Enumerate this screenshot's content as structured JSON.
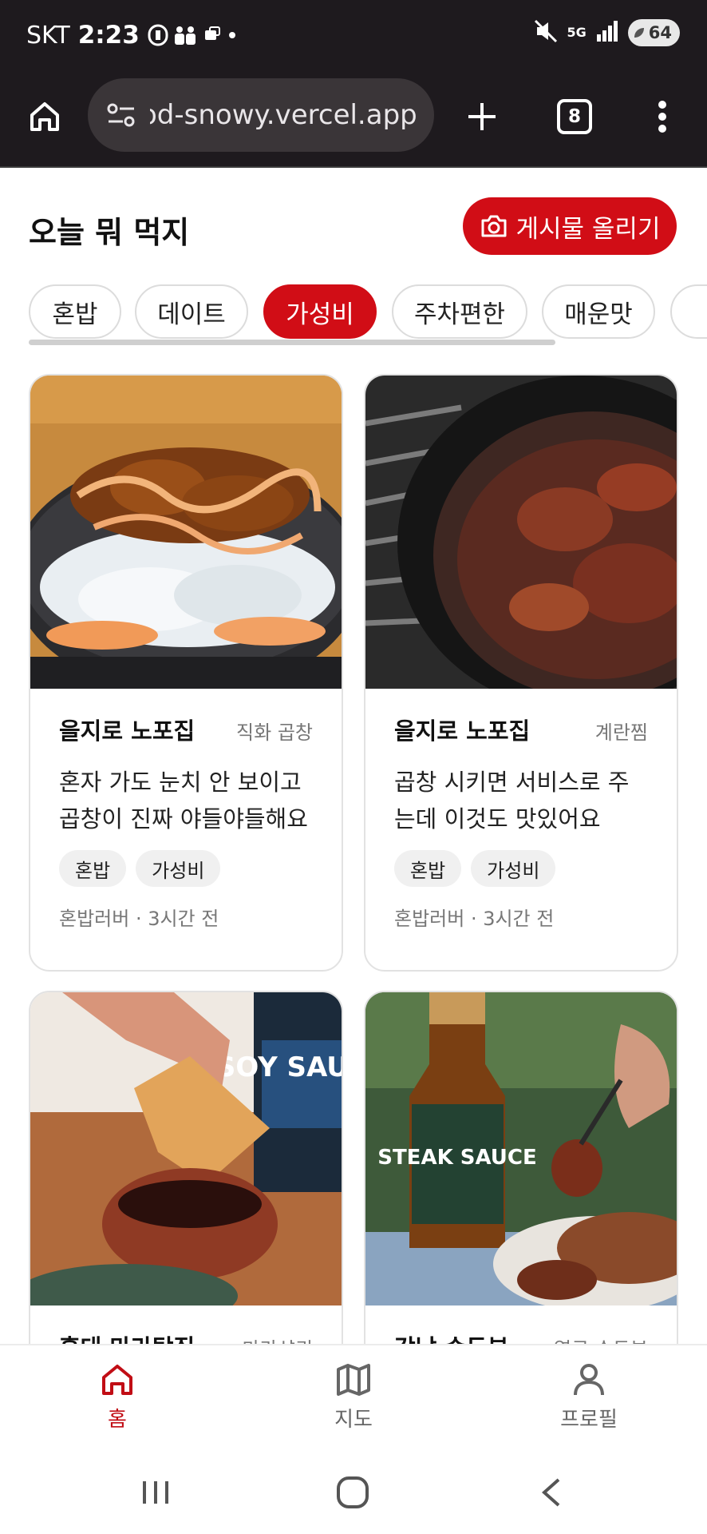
{
  "status_bar": {
    "carrier": "SKT",
    "time": "2:23",
    "network": "5G",
    "battery": "64"
  },
  "browser": {
    "url": "od-snowy.vercel.app",
    "tab_count": "8"
  },
  "header": {
    "title": "오늘 뭐 먹지",
    "post_button": "게시물 올리기"
  },
  "filters": {
    "chips": [
      "혼밥",
      "데이트",
      "가성비",
      "주차편한",
      "매운맛"
    ],
    "selected": "가성비"
  },
  "posts": [
    {
      "restaurant": "을지로 노포집",
      "menu": "직화 곱창",
      "description": "혼자 가도 눈치 안 보이고 곱창이 진짜 야들야들해요",
      "tags": [
        "혼밥",
        "가성비"
      ],
      "meta": "혼밥러버 · 3시간 전",
      "image": "rice-bowl-with-crispy-chicken"
    },
    {
      "restaurant": "을지로 노포집",
      "menu": "계란찜",
      "description": "곱창 시키면 서비스로 주는데 이것도 맛있어요",
      "tags": [
        "혼밥",
        "가성비"
      ],
      "meta": "혼밥러버 · 3시간 전",
      "image": "skillet-with-crispy-meat"
    },
    {
      "restaurant": "홍대 마라탕집",
      "menu": "마라샹궈",
      "image": "dumpling-dipped-in-soy-sauce",
      "label": "SOY SAUCE"
    },
    {
      "restaurant": "강남 순두부",
      "menu": "열큰 순두부",
      "image": "steak-sauce-bottle-and-steak",
      "label": "STEAK SAUCE"
    }
  ],
  "bottom_nav": {
    "items": [
      "홈",
      "지도",
      "프로필"
    ],
    "active": "홈"
  },
  "colors": {
    "accent": "#d10d16",
    "status_bar_bg": "#1e1a1e"
  }
}
